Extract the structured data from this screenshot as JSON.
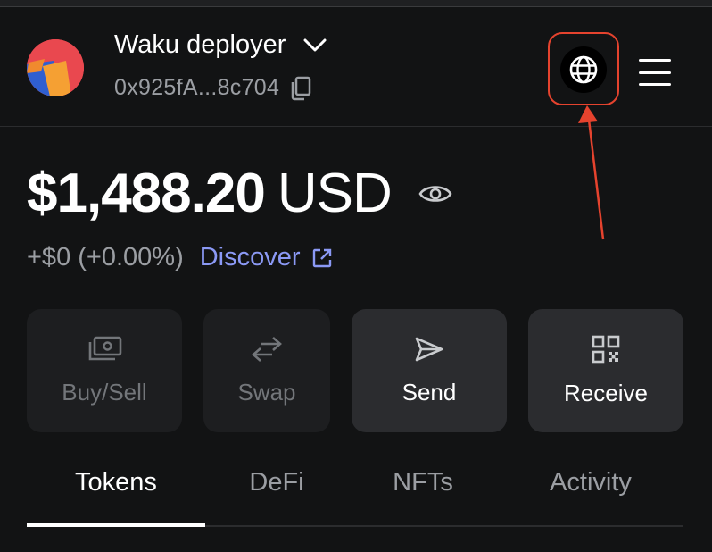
{
  "account": {
    "name": "Waku deployer",
    "address": "0x925fA...8c704"
  },
  "icons": {
    "chevron": "chevron-down-icon",
    "copy": "copy-icon",
    "globe": "globe-icon",
    "menu": "hamburger-menu-icon",
    "eye": "eye-icon",
    "external": "external-link-icon"
  },
  "balance": {
    "amount": "$1,488.20",
    "currency": "USD",
    "change": "+$0 (+0.00%)",
    "discover_label": "Discover"
  },
  "actions": [
    {
      "label": "Buy/Sell",
      "icon": "money-icon",
      "enabled": false
    },
    {
      "label": "Swap",
      "icon": "swap-arrows-icon",
      "enabled": false
    },
    {
      "label": "Send",
      "icon": "send-icon",
      "enabled": true
    },
    {
      "label": "Receive",
      "icon": "qr-code-icon",
      "enabled": true
    }
  ],
  "tabs": [
    {
      "label": "Tokens",
      "active": true
    },
    {
      "label": "DeFi",
      "active": false
    },
    {
      "label": "NFTs",
      "active": false
    },
    {
      "label": "Activity",
      "active": false
    }
  ],
  "colors": {
    "background": "#121314",
    "accent_link": "#8b99f5",
    "annotation_red": "#e5432e"
  }
}
